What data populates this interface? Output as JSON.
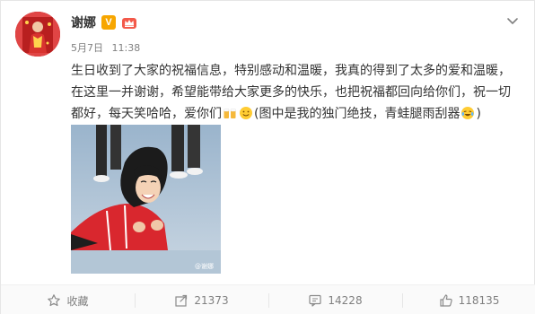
{
  "post": {
    "author": {
      "name": "谢娜",
      "verified_mark": "V",
      "avatar_icon": "avatar-icon",
      "verified_icon": "verified-icon",
      "member_icon": "crown-member-icon"
    },
    "meta": {
      "date": "5月7日",
      "time": "11:38"
    },
    "text_lines": [
      "生日收到了大家的祝福信息，特别感动和温暖，我真的得到了太多的爱和温暖，",
      "在这里一并谢谢，希望能带给大家更多的快乐，也把祝福都回向给你们，祝一切",
      "都好，每天笑哈哈，爱你们",
      "(图中是我的独门绝技，青蛙腿雨刮器",
      ")"
    ],
    "emojis": [
      "beer-cheers-icon",
      "smile-icon",
      "laugh-cry-icon"
    ],
    "photo": {
      "alt": "photo-of-girl-in-red-jersey",
      "watermark": "@谢娜"
    }
  },
  "actions": [
    {
      "icon": "star-icon",
      "label": "收藏"
    },
    {
      "icon": "share-icon",
      "label": "21373"
    },
    {
      "icon": "comment-icon",
      "label": "14228"
    },
    {
      "icon": "like-icon",
      "label": "118135"
    }
  ],
  "colors": {
    "text": "#333333",
    "meta": "#808080",
    "verified": "#f7a600",
    "action_bar_bg": "#fafafa"
  }
}
